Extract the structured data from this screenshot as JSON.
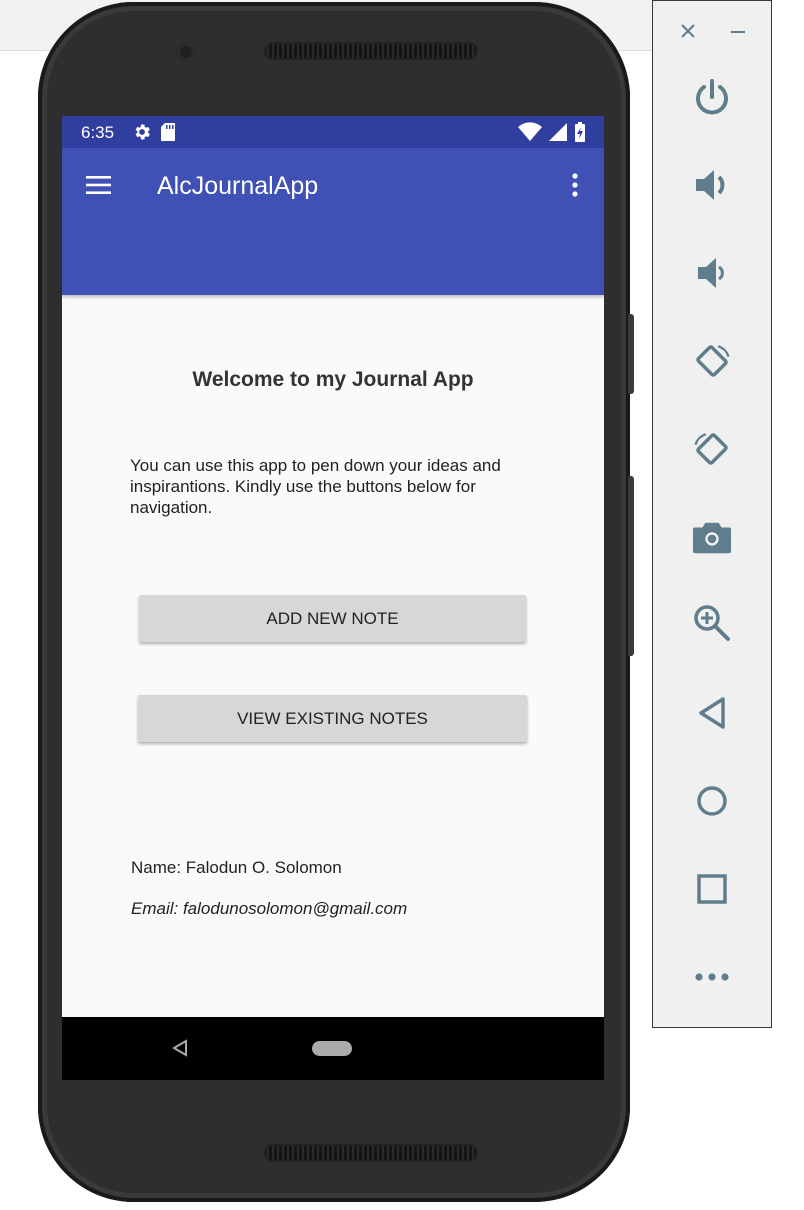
{
  "colors": {
    "status_bar": "#303f9f",
    "primary": "#3f51b5",
    "button": "#d6d7d7",
    "panel_icon": "#5f7d8c"
  },
  "status_bar": {
    "time": "6:35",
    "icons": [
      "settings-icon",
      "sd-card-icon",
      "wifi-icon",
      "signal-icon",
      "battery-icon"
    ]
  },
  "toolbar": {
    "title": "AlcJournalApp",
    "menu_icon": "hamburger-icon",
    "overflow_icon": "overflow-menu-icon"
  },
  "main": {
    "heading": "Welcome to my Journal App",
    "description": "You can use this app to pen down your ideas and inspirantions. Kindly use the buttons below for navigation.",
    "add_note_label": "ADD NEW NOTE",
    "view_notes_label": "VIEW EXISTING NOTES",
    "name_text": "Name: Falodun O. Solomon",
    "email_text": "Email: falodunosolomon@gmail.com"
  },
  "nav_bar": {
    "icons": [
      "back-icon",
      "home-icon"
    ]
  },
  "emulator_panel": {
    "controls": [
      "close-icon",
      "minimize-icon",
      "power-icon",
      "volume-up-icon",
      "volume-down-icon",
      "rotate-left-icon",
      "rotate-right-icon",
      "camera-icon",
      "zoom-icon",
      "back-icon",
      "home-icon",
      "overview-icon",
      "more-icon"
    ]
  }
}
